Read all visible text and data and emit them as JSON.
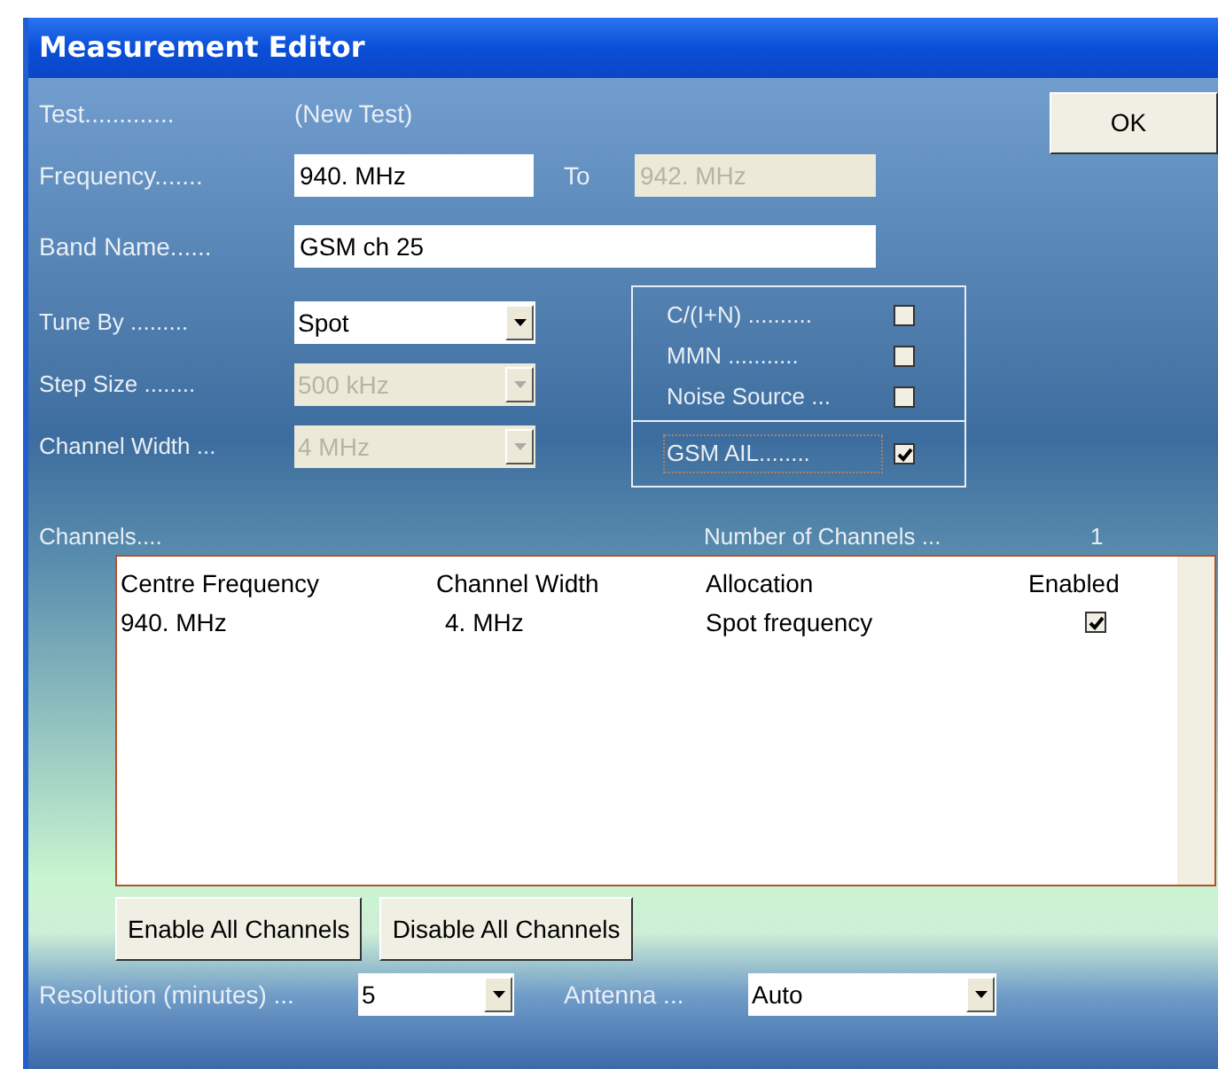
{
  "window": {
    "title": "Measurement Editor"
  },
  "ok_button": "OK",
  "test": {
    "label": "Test.............",
    "value": "(New Test)"
  },
  "frequency": {
    "label": "Frequency.......",
    "value": "940. MHz",
    "to_label": "To",
    "to_value": "942. MHz",
    "to_disabled": true
  },
  "band_name": {
    "label": "Band Name......",
    "value": "GSM ch 25"
  },
  "selects": [
    {
      "label": "Tune By .........",
      "value": "Spot",
      "disabled": false
    },
    {
      "label": "Step Size ........",
      "value": "500 kHz",
      "disabled": true
    },
    {
      "label": "Channel Width ...",
      "value": "4 MHz",
      "disabled": true
    }
  ],
  "options": [
    {
      "label": "C/(I+N) ..........",
      "checked": false
    },
    {
      "label": "MMN ...........",
      "checked": false
    },
    {
      "label": "Noise Source ...",
      "checked": false
    }
  ],
  "gsm_ail": {
    "label": "GSM AIL........",
    "checked": true,
    "focused": true
  },
  "channels": {
    "label": "Channels....",
    "count_label": "Number of Channels ...",
    "count": "1",
    "columns": [
      "Centre Frequency",
      "Channel Width",
      "Allocation",
      "Enabled"
    ],
    "rows": [
      {
        "centre_frequency": "940. MHz",
        "channel_width": "4. MHz",
        "allocation": "Spot frequency",
        "enabled": true
      }
    ]
  },
  "buttons": [
    "Enable All Channels",
    "Disable All Channels"
  ],
  "resolution": {
    "label": "Resolution (minutes) ...",
    "value": "5"
  },
  "antenna": {
    "label": "Antenna ...",
    "value": "Auto"
  }
}
